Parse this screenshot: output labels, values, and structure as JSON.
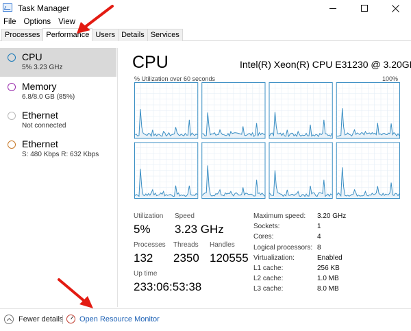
{
  "window": {
    "title": "Task Manager"
  },
  "menu": [
    "File",
    "Options",
    "View"
  ],
  "tabs": [
    {
      "label": "Processes",
      "active": false
    },
    {
      "label": "Performance",
      "active": true
    },
    {
      "label": "Users",
      "active": false
    },
    {
      "label": "Details",
      "active": false
    },
    {
      "label": "Services",
      "active": false
    }
  ],
  "sidebar": [
    {
      "title": "CPU",
      "subtitle": "5% 3.23 GHz",
      "color": "#1a7ab8",
      "selected": true
    },
    {
      "title": "Memory",
      "subtitle": "6.8/8.0 GB (85%)",
      "color": "#9b2fae",
      "selected": false
    },
    {
      "title": "Ethernet",
      "subtitle": "Not connected",
      "color": "#b8b8b8",
      "selected": false
    },
    {
      "title": "Ethernet",
      "subtitle": "S: 480 Kbps  R: 632 Kbps",
      "color": "#c87a2a",
      "selected": false
    }
  ],
  "main": {
    "heading": "CPU",
    "model": "Intel(R) Xeon(R) CPU E31230 @ 3.20GHz",
    "graph_label": "% Utilization over 60 seconds",
    "graph_max": "100%",
    "graph_color": "#3b8fc4",
    "graph_fill": "#e9f2f9",
    "stats": {
      "utilization": {
        "label": "Utilization",
        "value": "5%"
      },
      "speed": {
        "label": "Speed",
        "value": "3.23 GHz"
      },
      "processes": {
        "label": "Processes",
        "value": "132"
      },
      "threads": {
        "label": "Threads",
        "value": "2350"
      },
      "handles": {
        "label": "Handles",
        "value": "120555"
      },
      "uptime": {
        "label": "Up time",
        "value": "233:06:53:38"
      }
    },
    "specs": [
      {
        "label": "Maximum speed:",
        "value": "3.20 GHz"
      },
      {
        "label": "Sockets:",
        "value": "1"
      },
      {
        "label": "Cores:",
        "value": "4"
      },
      {
        "label": "Logical processors:",
        "value": "8"
      },
      {
        "label": "Virtualization:",
        "value": "Enabled"
      },
      {
        "label": "L1 cache:",
        "value": "256 KB"
      },
      {
        "label": "L2 cache:",
        "value": "1.0 MB"
      },
      {
        "label": "L3 cache:",
        "value": "8.0 MB"
      }
    ]
  },
  "footer": {
    "fewer_details": "Fewer details",
    "resource_monitor": "Open Resource Monitor"
  },
  "annotation_color": "#e31b12"
}
